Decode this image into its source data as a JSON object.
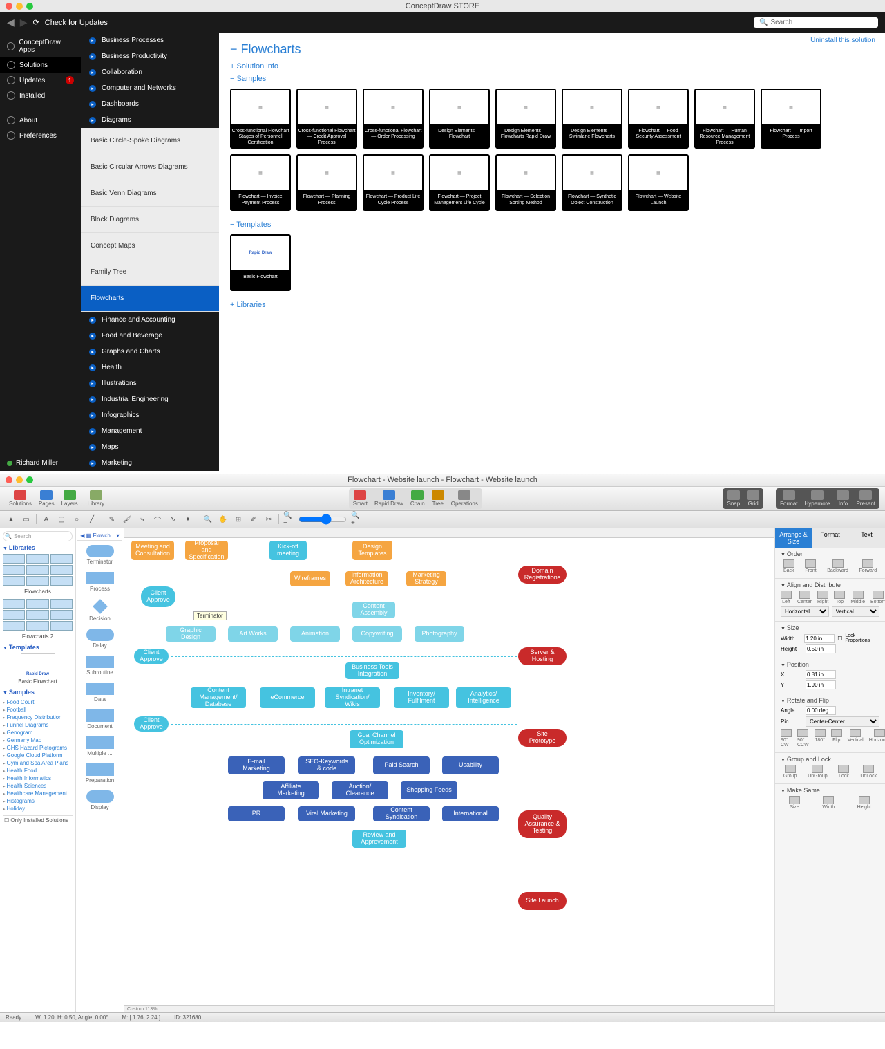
{
  "store": {
    "title": "ConceptDraw STORE",
    "check_updates": "Check for Updates",
    "search_placeholder": "Search",
    "leftnav": [
      {
        "label": "ConceptDraw Apps"
      },
      {
        "label": "Solutions",
        "selected": true
      },
      {
        "label": "Updates",
        "badge": "1"
      },
      {
        "label": "Installed"
      },
      {
        "label": "About",
        "sep": true
      },
      {
        "label": "Preferences"
      }
    ],
    "user": "Richard Miller",
    "categories_top": [
      "Business Processes",
      "Business Productivity",
      "Collaboration",
      "Computer and Networks",
      "Dashboards",
      "Diagrams"
    ],
    "categories_sub": [
      {
        "label": "Basic Circle-Spoke Diagrams"
      },
      {
        "label": "Basic Circular Arrows Diagrams"
      },
      {
        "label": "Basic Venn Diagrams"
      },
      {
        "label": "Block Diagrams"
      },
      {
        "label": "Concept Maps"
      },
      {
        "label": "Family Tree"
      },
      {
        "label": "Flowcharts",
        "active": true
      }
    ],
    "categories_bot": [
      "Finance and Accounting",
      "Food and Beverage",
      "Graphs and Charts",
      "Health",
      "Illustrations",
      "Industrial Engineering",
      "Infographics",
      "Management",
      "Maps",
      "Marketing"
    ],
    "content": {
      "uninstall": "Uninstall this solution",
      "title": "Flowcharts",
      "solution_info": "Solution info",
      "samples_label": "Samples",
      "samples": [
        "Cross-functional Flowchart Stages of Personnel Certification",
        "Cross-functional Flowchart — Credit Approval Process",
        "Cross-functional Flowchart — Order Processing",
        "Design Elements — Flowchart",
        "Design Elements — Flowcharts Rapid Draw",
        "Design Elements — Swimlane Flowcharts",
        "Flowchart — Food Security Assessment",
        "Flowchart — Human Resource Management Process",
        "Flowchart — Import Process",
        "Flowchart — Invoice Payment Process",
        "Flowchart — Planning Process",
        "Flowchart — Product Life Cycle Process",
        "Flowchart — Project Management Life Cycle",
        "Flowchart — Selection Sorting Method",
        "Flowchart — Synthetic Object Construction",
        "Flowchart — Website Launch"
      ],
      "templates_label": "Templates",
      "templates": [
        "Basic Flowchart"
      ],
      "libraries_label": "Libraries"
    }
  },
  "pro": {
    "title": "Flowchart - Website launch - Flowchart - Website launch",
    "toolbar_left": [
      "Solutions",
      "Pages",
      "Layers"
    ],
    "toolbar_lib": "Library",
    "toolbar_mid": [
      "Smart",
      "Rapid Draw",
      "Chain",
      "Tree",
      "Operations"
    ],
    "toolbar_r1": [
      "Snap",
      "Grid"
    ],
    "toolbar_r2": [
      "Format",
      "Hypernote",
      "Info",
      "Present"
    ],
    "left": {
      "search": "Search",
      "libraries": "Libraries",
      "flowcharts": "Flowcharts",
      "flowcharts2": "Flowcharts 2",
      "templates": "Templates",
      "basic_flowchart": "Basic Flowchart",
      "rapid_draw": "Rapid Draw",
      "samples": "Samples",
      "sample_list": [
        "Food Court",
        "Football",
        "Frequency Distribution",
        "Funnel Diagrams",
        "Genogram",
        "Germany Map",
        "GHS Hazard Pictograms",
        "Google Cloud Platform",
        "Gym and Spa Area Plans",
        "Health Food",
        "Health Informatics",
        "Health Sciences",
        "Healthcare Management",
        "Histograms",
        "Holiday"
      ],
      "only_installed": "Only Installed Solutions"
    },
    "shapes": {
      "tab": "Flowch...",
      "items": [
        "Terminator",
        "Process",
        "Decision",
        "Delay",
        "Subroutine",
        "Data",
        "Document",
        "Multiple ...",
        "Preparation",
        "Display"
      ],
      "tooltip": "Terminator"
    },
    "canvas": {
      "row1": [
        "Meeting and Consultation",
        "Proposal and Specification",
        "Kick-off meeting",
        "Design Templates"
      ],
      "row2": [
        "Wireframes",
        "Information Architecture",
        "Marketing Strategy"
      ],
      "red": [
        "Domain Registrations",
        "Server & Hosting",
        "Site Prototype",
        "Quality Assurance & Testing",
        "Site Launch"
      ],
      "approve": "Client Approve",
      "content_assembly": "Content Assembly",
      "row3": [
        "Graphic Design",
        "Art Works",
        "Animation",
        "Copywriting",
        "Photography"
      ],
      "biz_tools": "Business Tools Integration",
      "row4": [
        "Content Management/ Database",
        "eCommerce",
        "Intranet Syndication/ Wikis",
        "Inventory/ Fulfilment",
        "Analytics/ Intelligence"
      ],
      "goal": "Goal Channel Optimization",
      "row5a": [
        "E-mail Marketing",
        "SEO-Keywords & code",
        "Paid Search",
        "Usability"
      ],
      "row5b": [
        "Affiliate Marketing",
        "Auction/ Clearance",
        "Shopping Feeds"
      ],
      "row5c": [
        "PR",
        "Viral Marketing",
        "Content Syndication",
        "International"
      ],
      "review": "Review and Approvement",
      "zoom": "Custom 113%"
    },
    "right": {
      "tabs": [
        "Arrange & Size",
        "Format",
        "Text"
      ],
      "order": {
        "label": "Order",
        "items": [
          "Back",
          "Front",
          "Backward",
          "Forward"
        ]
      },
      "align": {
        "label": "Align and Distribute",
        "items": [
          "Left",
          "Center",
          "Right",
          "Top",
          "Middle",
          "Bottom"
        ],
        "h": "Horizontal",
        "v": "Vertical"
      },
      "size": {
        "label": "Size",
        "width": "Width",
        "width_v": "1.20 in",
        "height": "Height",
        "height_v": "0.50 in",
        "lock": "Lock Proportions"
      },
      "pos": {
        "label": "Position",
        "x": "X",
        "x_v": "0.81 in",
        "y": "Y",
        "y_v": "1.90 in"
      },
      "rotate": {
        "label": "Rotate and Flip",
        "angle": "Angle",
        "angle_v": "0.00 deg",
        "pin": "Pin",
        "pin_v": "Center-Center",
        "items": [
          "90° CW",
          "90° CCW",
          "180°",
          "Flip",
          "Vertical",
          "Horizontal"
        ]
      },
      "group": {
        "label": "Group and Lock",
        "items": [
          "Group",
          "UnGroup",
          "Lock",
          "UnLock"
        ]
      },
      "make": {
        "label": "Make Same",
        "items": [
          "Size",
          "Width",
          "Height"
        ]
      }
    },
    "status": {
      "ready": "Ready",
      "dims": "W: 1.20, H: 0.50, Angle: 0.00°",
      "m": "M: [ 1.76, 2.24 ]",
      "id": "ID: 321680"
    }
  }
}
